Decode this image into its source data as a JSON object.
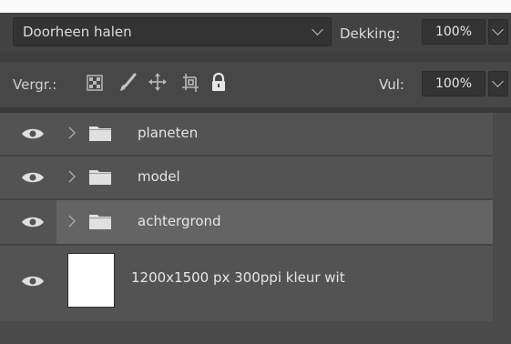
{
  "header": {
    "blend_mode": "Doorheen halen",
    "opacity_label": "Dekking:",
    "opacity_value": "100%",
    "lock_label": "Vergr.:",
    "fill_label": "Vul:",
    "fill_value": "100%"
  },
  "layers": [
    {
      "name": "planeten",
      "type": "group",
      "visible": true,
      "selected": false
    },
    {
      "name": "model",
      "type": "group",
      "visible": true,
      "selected": false
    },
    {
      "name": "achtergrond",
      "type": "group",
      "visible": true,
      "selected": true
    },
    {
      "name": "1200x1500 px 300ppi  kleur wit",
      "type": "pixel",
      "visible": true,
      "selected": false
    }
  ],
  "icons": [
    "chevron-down-icon",
    "lock-transparent-pixels-icon",
    "lock-image-pixels-icon",
    "lock-position-icon",
    "lock-artboard-icon",
    "lock-all-icon",
    "eye-icon",
    "expand-arrow-icon",
    "folder-icon"
  ],
  "colors": {
    "panel": "#535353",
    "selected_row": "#646464",
    "header_dark": "#424242",
    "field": "#333333"
  }
}
